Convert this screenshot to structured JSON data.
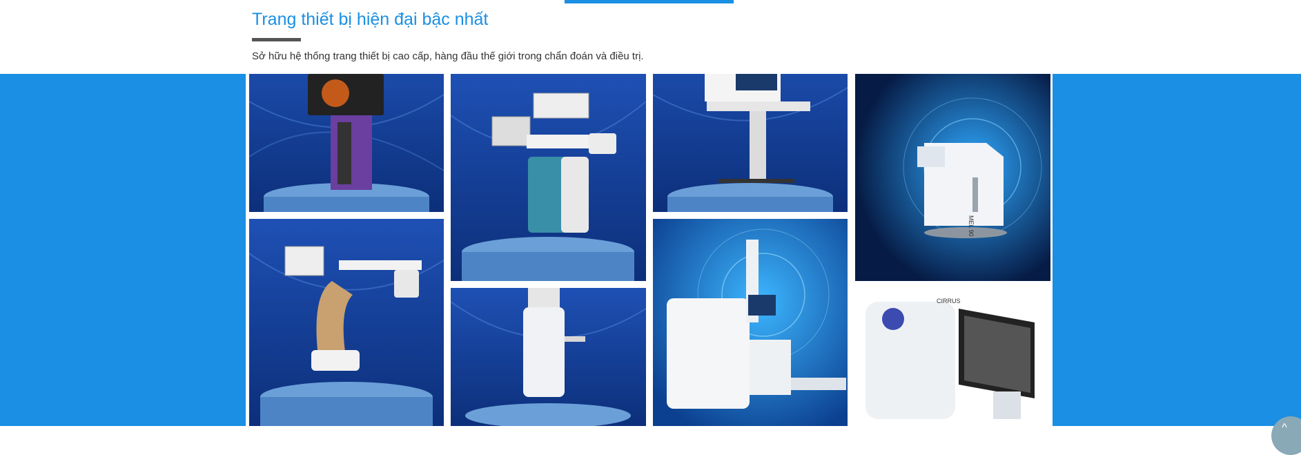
{
  "section": {
    "title": "Trang thiết bị hiện đại bậc nhất",
    "subtitle": "Sở hữu hệ thống trang thiết bị cao cấp, hàng đầu thế giới trong chẩn đoán và điều trị."
  },
  "colors": {
    "accent": "#1a8fe3",
    "rule": "#555555",
    "tile_blue": "#1d4fb0",
    "tile_dark": "#0a2a5e"
  },
  "gallery": {
    "images": [
      {
        "name": "surgical-console-image"
      },
      {
        "name": "excimer-laser-image"
      },
      {
        "name": "ophthalmic-workstation-image"
      },
      {
        "name": "femtosecond-laser-image",
        "label": "MEL 90"
      },
      {
        "name": "surgical-microscope-image"
      },
      {
        "name": "phaco-system-image"
      },
      {
        "name": "visumax-laser-image"
      },
      {
        "name": "oct-scanner-image",
        "label": "CIRRUS"
      }
    ]
  },
  "controls": {
    "scroll_top_icon": "chevron-up-icon",
    "scroll_top_glyph": "^"
  }
}
